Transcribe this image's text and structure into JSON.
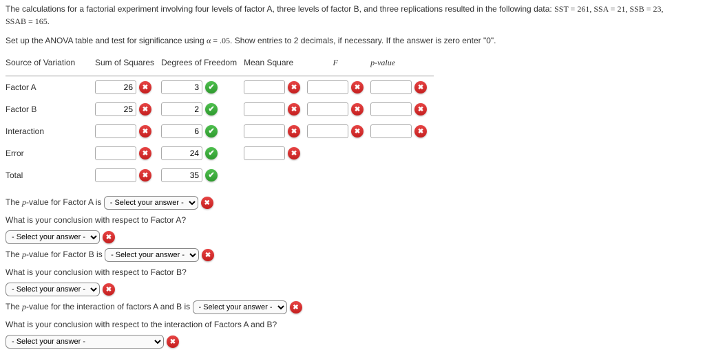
{
  "problem": {
    "line1_a": "The calculations for a factorial experiment involving four levels of factor A, three levels of factor B, and three replications resulted in the following data: ",
    "line1_b": "SST = 261, SSA = 21, SSB = 23,",
    "line2": "SSAB = 165.",
    "line3_a": "Set up the ANOVA table and test for significance using ",
    "line3_b": "α = .05",
    "line3_c": ". Show entries to 2 decimals, if necessary. If the answer is zero enter \"0\"."
  },
  "table": {
    "headers": {
      "source": "Source of Variation",
      "ss": "Sum of Squares",
      "df": "Degrees of Freedom",
      "ms": "Mean Square",
      "f": "F",
      "p": "p-value"
    },
    "rows": {
      "factorA": {
        "label": "Factor A",
        "ss": "26",
        "df": "3",
        "ms": "",
        "f": "",
        "p": ""
      },
      "factorB": {
        "label": "Factor B",
        "ss": "25",
        "df": "2",
        "ms": "",
        "f": "",
        "p": ""
      },
      "interaction": {
        "label": "Interaction",
        "ss": "",
        "df": "6",
        "ms": "",
        "f": "",
        "p": ""
      },
      "error": {
        "label": "Error",
        "ss": "",
        "df": "24",
        "ms": ""
      },
      "total": {
        "label": "Total",
        "ss": "",
        "df": "35"
      }
    }
  },
  "questions": {
    "pA_prefix": "The ",
    "pA_mid": "-value for Factor A is",
    "concA": "What is your conclusion with respect to Factor A?",
    "pB_prefix": "The ",
    "pB_mid": "-value for Factor B is",
    "concB": "What is your conclusion with respect to Factor B?",
    "pAB_prefix": "The ",
    "pAB_mid": "-value for the interaction of factors A and B is",
    "concAB": "What is your conclusion with respect to the interaction of Factors A and B?"
  },
  "select_placeholder": "- Select your answer -",
  "p_letter": "p"
}
